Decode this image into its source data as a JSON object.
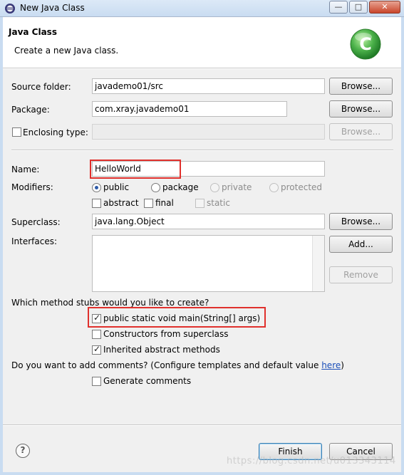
{
  "window": {
    "title": "New Java Class",
    "min_glyph": "—",
    "max_glyph": "□",
    "close_glyph": "✕"
  },
  "header": {
    "title": "Java Class",
    "description": "Create a new Java class.",
    "logo_letter": "C"
  },
  "form": {
    "source_folder_label": "Source folder:",
    "source_folder_value": "javademo01/src",
    "package_label": "Package:",
    "package_value": "com.xray.javademo01",
    "enclosing_type_label": "Enclosing type:",
    "enclosing_type_value": "",
    "name_label": "Name:",
    "name_value": "HelloWorld",
    "modifiers_label": "Modifiers:",
    "modifiers": {
      "public": "public",
      "package": "package",
      "private": "private",
      "protected": "protected",
      "abstract": "abstract",
      "final": "final",
      "static": "static"
    },
    "superclass_label": "Superclass:",
    "superclass_value": "java.lang.Object",
    "interfaces_label": "Interfaces:",
    "stubs_question": "Which method stubs would you like to create?",
    "stub_main": "public static void main(String[] args)",
    "stub_constructors": "Constructors from superclass",
    "stub_inherited": "Inherited abstract methods",
    "comments_question": "Do you want to add comments? (Configure templates and default value",
    "comments_link": "here",
    "comments_close": ")",
    "generate_comments": "Generate comments"
  },
  "buttons": {
    "browse": "Browse...",
    "add": "Add...",
    "remove": "Remove",
    "finish": "Finish",
    "cancel": "Cancel",
    "help": "?"
  },
  "watermark": "https://blog.csdn.net/u013343114",
  "colors": {
    "highlight_box": "#e0302c",
    "link": "#1a4eb8",
    "logo_green": "#4cb24a"
  }
}
